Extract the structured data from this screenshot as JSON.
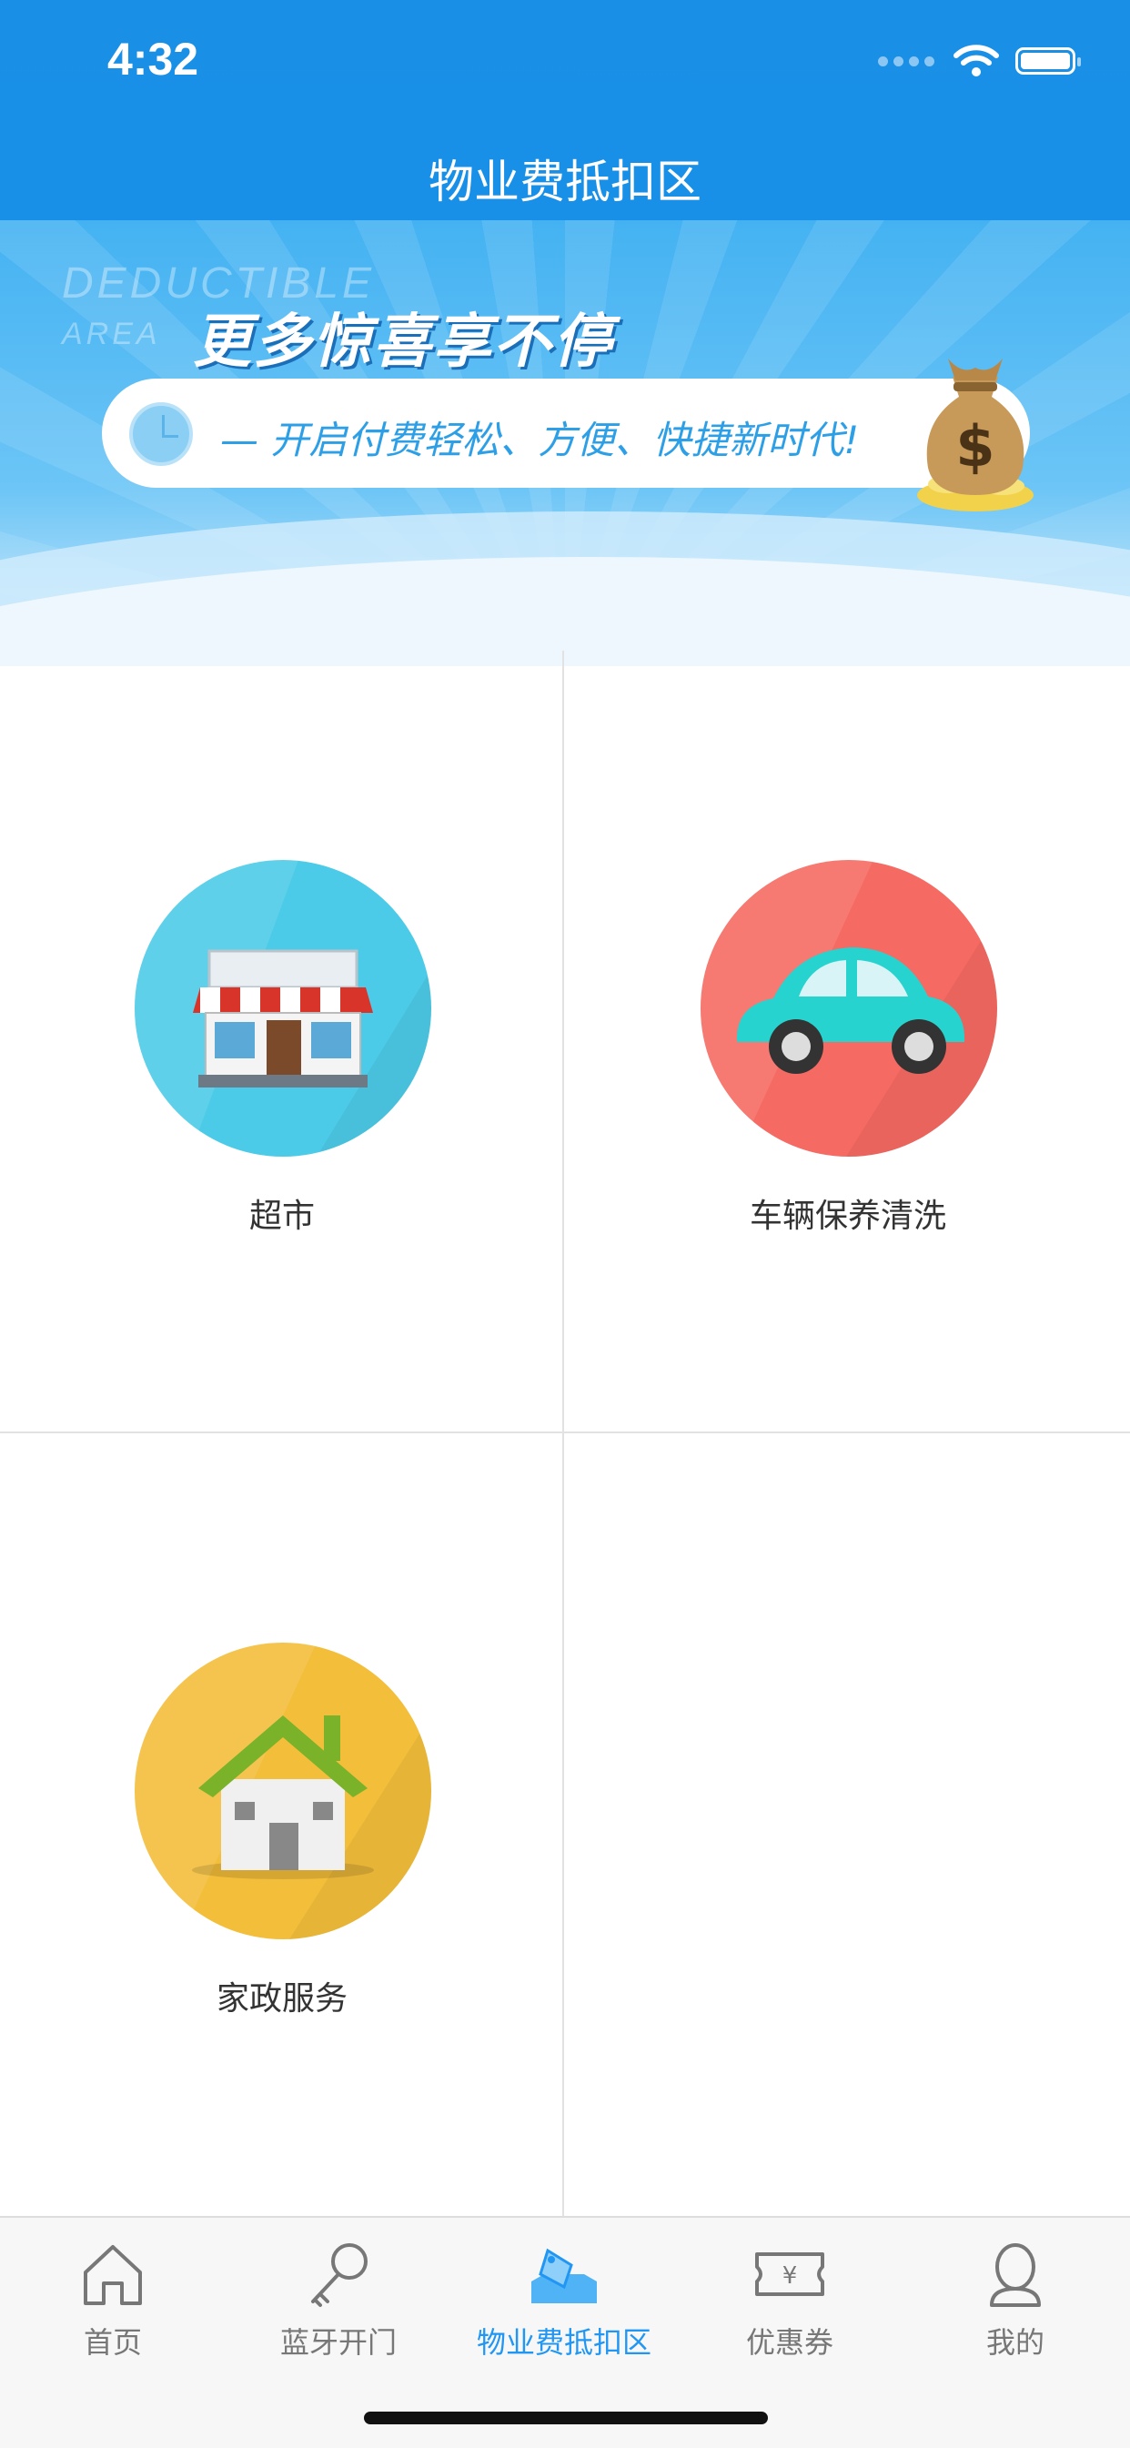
{
  "status_bar": {
    "time": "4:32"
  },
  "header": {
    "title": "物业费抵扣区"
  },
  "banner": {
    "deduct_line1": "DEDUCTIBLE",
    "deduct_line2": "AREA",
    "slogan": "更多惊喜享不停",
    "subtitle": "— 开启付费轻松、方便、快捷新时代!",
    "icons": [
      "clock-icon",
      "money-bag-icon"
    ]
  },
  "categories": [
    {
      "label": "超市",
      "icon": "supermarket-icon",
      "color": "#4ccbe8"
    },
    {
      "label": "车辆保养清洗",
      "icon": "car-icon",
      "color": "#f56a62"
    },
    {
      "label": "家政服务",
      "icon": "house-icon",
      "color": "#f3be3a"
    }
  ],
  "tabbar": {
    "active_color": "#2196f3",
    "inactive_color": "#777777",
    "items": [
      {
        "label": "首页",
        "icon": "home-icon"
      },
      {
        "label": "蓝牙开门",
        "icon": "key-icon"
      },
      {
        "label": "物业费抵扣区",
        "icon": "tag-icon",
        "active": true
      },
      {
        "label": "优惠券",
        "icon": "coupon-icon"
      },
      {
        "label": "我的",
        "icon": "user-icon"
      }
    ]
  }
}
